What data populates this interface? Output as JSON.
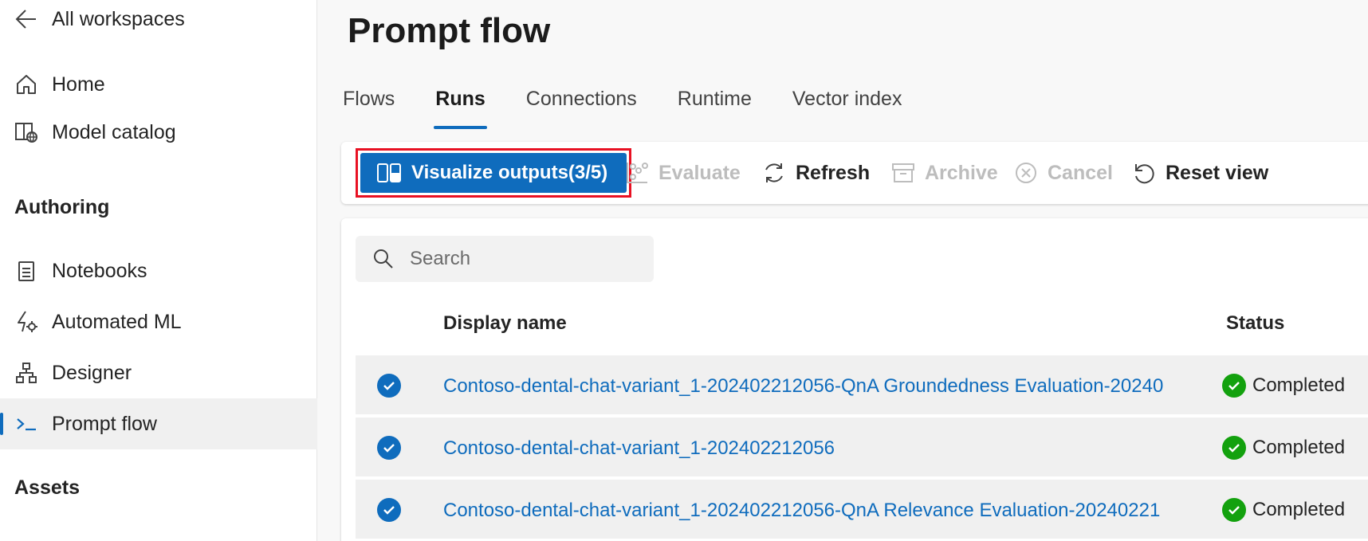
{
  "sidebar": {
    "back_label": "All workspaces",
    "items_top": [
      {
        "label": "Home",
        "icon": "home-icon"
      },
      {
        "label": "Model catalog",
        "icon": "model-catalog-icon"
      }
    ],
    "section_authoring": "Authoring",
    "items_authoring": [
      {
        "label": "Notebooks",
        "icon": "notebook-icon"
      },
      {
        "label": "Automated ML",
        "icon": "automated-ml-icon"
      },
      {
        "label": "Designer",
        "icon": "designer-icon"
      },
      {
        "label": "Prompt flow",
        "icon": "prompt-flow-icon",
        "active": true
      }
    ],
    "section_assets": "Assets"
  },
  "page": {
    "title": "Prompt flow",
    "tabs": [
      "Flows",
      "Runs",
      "Connections",
      "Runtime",
      "Vector index"
    ],
    "active_tab": "Runs"
  },
  "toolbar": {
    "visualize_label": "Visualize outputs(3/5)",
    "evaluate_label": "Evaluate",
    "refresh_label": "Refresh",
    "archive_label": "Archive",
    "cancel_label": "Cancel",
    "reset_view_label": "Reset view"
  },
  "search": {
    "placeholder": "Search"
  },
  "table": {
    "columns": [
      "Display name",
      "Status"
    ],
    "rows": [
      {
        "selected": true,
        "display_name": "Contoso-dental-chat-variant_1-202402212056-QnA Groundedness Evaluation-20240",
        "status": "Completed"
      },
      {
        "selected": true,
        "display_name": "Contoso-dental-chat-variant_1-202402212056",
        "status": "Completed"
      },
      {
        "selected": true,
        "display_name": "Contoso-dental-chat-variant_1-202402212056-QnA Relevance Evaluation-20240221",
        "status": "Completed"
      }
    ]
  },
  "colors": {
    "accent": "#0f6cbd",
    "highlight_border": "#e81123",
    "status_success": "#13a10e"
  }
}
